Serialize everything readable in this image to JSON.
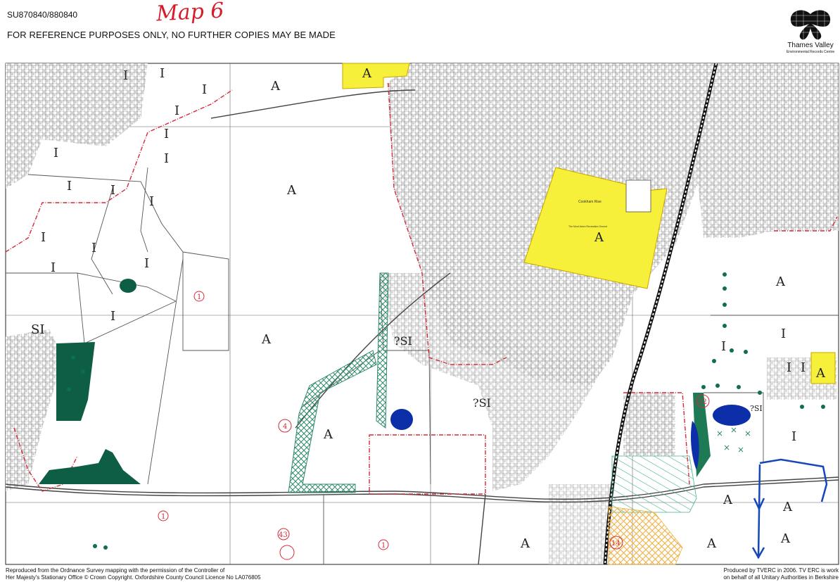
{
  "header": {
    "grid_ref": "SU870840/880840",
    "notice": "FOR REFERENCE PURPOSES ONLY, NO FURTHER COPIES MAY BE MADE",
    "map_number": "Map 6"
  },
  "logo": {
    "icon": "butterfly-icon",
    "name": "Thames Valley",
    "subtitle": "Environmental Records Centre"
  },
  "map": {
    "zone_labels": [
      "A",
      "I",
      "SI",
      "?SI"
    ],
    "site_numbers": [
      "1",
      "4",
      "14",
      "32",
      "43"
    ],
    "place_labels": [
      "Cookham Rise",
      "The Mont Aston Recreation Ground"
    ],
    "colors": {
      "allocation_yellow": "#f7f03a",
      "woodland_green": "#0e5e46",
      "water_blue": "#0c2ea8",
      "boundary_red": "#d42b3a",
      "hatch_orange": "#f0b040",
      "path_blue": "#1447b8"
    }
  },
  "footer": {
    "credit_left_line1": "Reproduced from the Ordnance Survey mapping with the permission of the Controller of",
    "credit_left_line2": "Her Majesty's Stationary Office © Crown Copyright. Oxfordshire County Council Licence No LA076805",
    "credit_right_line1": "Produced by TVERC in 2006. TV ERC is work",
    "credit_right_line2": "on behalf of all Unitary Authorities in Berkshire"
  }
}
